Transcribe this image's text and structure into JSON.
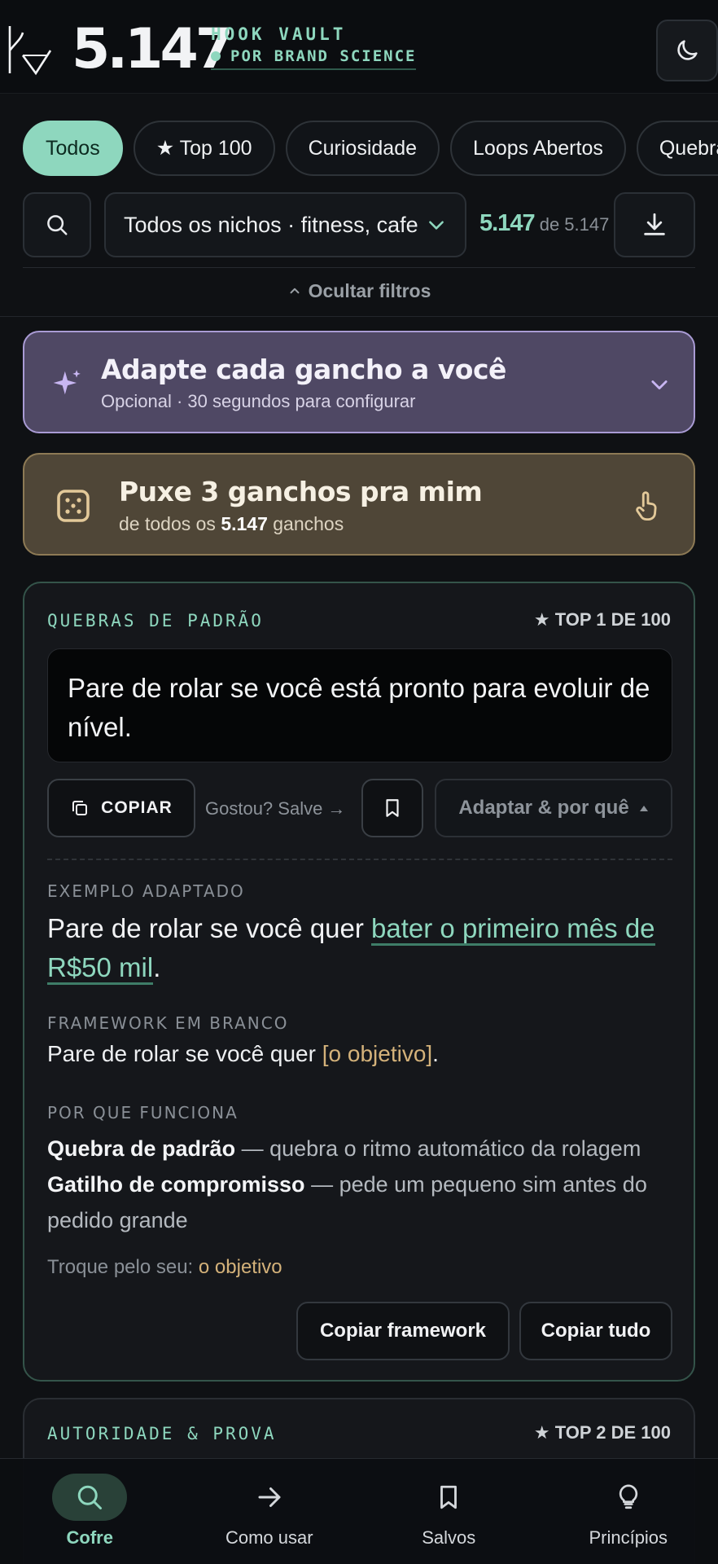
{
  "header": {
    "count": "5.147",
    "brand_title": "HOOK VAULT",
    "brand_sub": "POR BRAND SCIENCE",
    "accent": "#8ed7be",
    "theme_icon": "moon-icon"
  },
  "chips": [
    {
      "label": "Todos",
      "active": true
    },
    {
      "label": "★ Top 100",
      "active": false
    },
    {
      "label": "Curiosidade",
      "active": false
    },
    {
      "label": "Loops Abertos",
      "active": false
    },
    {
      "label": "Quebras de Padrão",
      "active": false
    }
  ],
  "filters": {
    "niche_value": "Todos os nichos · fitness, cafe",
    "shown": "5.147",
    "of_total": "de 5.147",
    "hide_label": "Ocultar filtros"
  },
  "adapt_banner": {
    "title": "Adapte cada gancho a você",
    "subtitle": "Opcional · 30 segundos para configurar",
    "color": "#4f4864"
  },
  "pull_banner": {
    "title": "Puxe 3 ganchos pra mim",
    "sub_prefix": "de todos os",
    "sub_count": "5.147",
    "sub_suffix": "ganchos",
    "color": "#4f4637"
  },
  "card1": {
    "category": "QUEBRAS DE PADRÃO",
    "rank": "★ TOP 1 DE 100",
    "hook": "Pare de rolar se você está pronto para evoluir de nível.",
    "copy_label": "COPIAR",
    "save_hint": "Gostou? Salve →",
    "adapt_why_label": "Adaptar & por quê",
    "example_label": "EXEMPLO ADAPTADO",
    "example_prefix": "Pare de rolar se você quer ",
    "example_highlight": "bater o primeiro mês de R$50 mil",
    "example_suffix": ".",
    "framework_label": "FRAMEWORK EM BRANCO",
    "framework_prefix": "Pare de rolar se você quer ",
    "framework_placeholder": "[o objetivo]",
    "framework_suffix": ".",
    "why_label": "POR QUE FUNCIONA",
    "reasons": [
      {
        "name": "Quebra de padrão",
        "desc": " — quebra o ritmo automático da rolagem"
      },
      {
        "name": "Gatilho de compromisso",
        "desc": " — pede um pequeno sim antes do pedido grande"
      }
    ],
    "swap_prefix": "Troque pelo seu: ",
    "swap_value": "o objetivo",
    "copy_framework_label": "Copiar framework",
    "copy_all_label": "Copiar tudo"
  },
  "card2": {
    "category": "AUTORIDADE & PROVA",
    "rank": "★ TOP 2 DE 100"
  },
  "bottom_nav": [
    {
      "label": "Cofre",
      "icon": "search-icon",
      "active": true
    },
    {
      "label": "Como usar",
      "icon": "arrow-right-icon",
      "active": false
    },
    {
      "label": "Salvos",
      "icon": "bookmark-icon",
      "active": false
    },
    {
      "label": "Princípios",
      "icon": "lightbulb-icon",
      "active": false
    }
  ]
}
